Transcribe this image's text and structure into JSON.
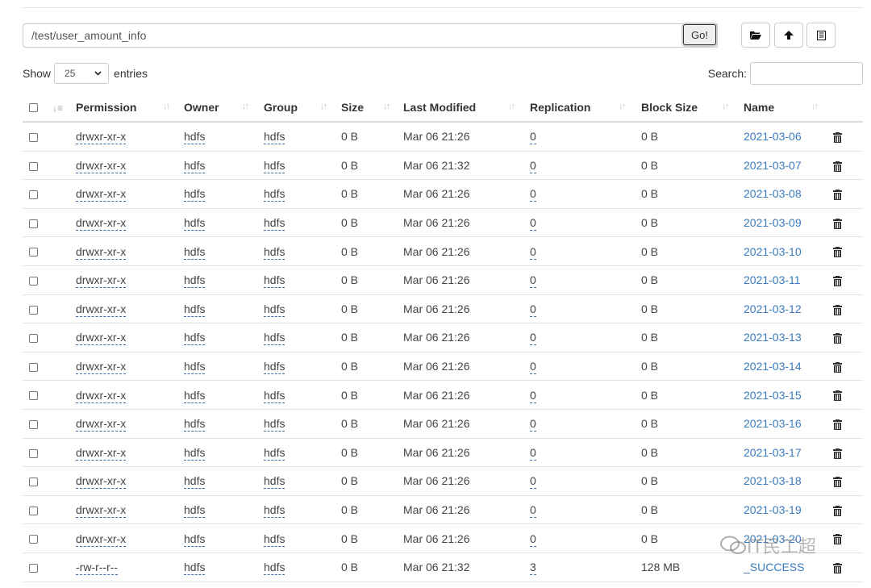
{
  "path_bar": {
    "path_value": "/test/user_amount_info",
    "go_label": "Go!"
  },
  "toolbar": {
    "icons": [
      "folder-open-icon",
      "upload-icon",
      "list-icon"
    ]
  },
  "length_control": {
    "show_label": "Show",
    "selected_value": "25",
    "entries_label": "entries"
  },
  "search": {
    "label": "Search:",
    "value": ""
  },
  "table": {
    "headers": [
      "Permission",
      "Owner",
      "Group",
      "Size",
      "Last Modified",
      "Replication",
      "Block Size",
      "Name"
    ],
    "rows": [
      {
        "permission": "drwxr-xr-x",
        "owner": "hdfs",
        "group": "hdfs",
        "size": "0 B",
        "modified": "Mar 06 21:26",
        "replication": "0",
        "block_size": "0 B",
        "name": "2021-03-06"
      },
      {
        "permission": "drwxr-xr-x",
        "owner": "hdfs",
        "group": "hdfs",
        "size": "0 B",
        "modified": "Mar 06 21:32",
        "replication": "0",
        "block_size": "0 B",
        "name": "2021-03-07"
      },
      {
        "permission": "drwxr-xr-x",
        "owner": "hdfs",
        "group": "hdfs",
        "size": "0 B",
        "modified": "Mar 06 21:26",
        "replication": "0",
        "block_size": "0 B",
        "name": "2021-03-08"
      },
      {
        "permission": "drwxr-xr-x",
        "owner": "hdfs",
        "group": "hdfs",
        "size": "0 B",
        "modified": "Mar 06 21:26",
        "replication": "0",
        "block_size": "0 B",
        "name": "2021-03-09"
      },
      {
        "permission": "drwxr-xr-x",
        "owner": "hdfs",
        "group": "hdfs",
        "size": "0 B",
        "modified": "Mar 06 21:26",
        "replication": "0",
        "block_size": "0 B",
        "name": "2021-03-10"
      },
      {
        "permission": "drwxr-xr-x",
        "owner": "hdfs",
        "group": "hdfs",
        "size": "0 B",
        "modified": "Mar 06 21:26",
        "replication": "0",
        "block_size": "0 B",
        "name": "2021-03-11"
      },
      {
        "permission": "drwxr-xr-x",
        "owner": "hdfs",
        "group": "hdfs",
        "size": "0 B",
        "modified": "Mar 06 21:26",
        "replication": "0",
        "block_size": "0 B",
        "name": "2021-03-12"
      },
      {
        "permission": "drwxr-xr-x",
        "owner": "hdfs",
        "group": "hdfs",
        "size": "0 B",
        "modified": "Mar 06 21:26",
        "replication": "0",
        "block_size": "0 B",
        "name": "2021-03-13"
      },
      {
        "permission": "drwxr-xr-x",
        "owner": "hdfs",
        "group": "hdfs",
        "size": "0 B",
        "modified": "Mar 06 21:26",
        "replication": "0",
        "block_size": "0 B",
        "name": "2021-03-14"
      },
      {
        "permission": "drwxr-xr-x",
        "owner": "hdfs",
        "group": "hdfs",
        "size": "0 B",
        "modified": "Mar 06 21:26",
        "replication": "0",
        "block_size": "0 B",
        "name": "2021-03-15"
      },
      {
        "permission": "drwxr-xr-x",
        "owner": "hdfs",
        "group": "hdfs",
        "size": "0 B",
        "modified": "Mar 06 21:26",
        "replication": "0",
        "block_size": "0 B",
        "name": "2021-03-16"
      },
      {
        "permission": "drwxr-xr-x",
        "owner": "hdfs",
        "group": "hdfs",
        "size": "0 B",
        "modified": "Mar 06 21:26",
        "replication": "0",
        "block_size": "0 B",
        "name": "2021-03-17"
      },
      {
        "permission": "drwxr-xr-x",
        "owner": "hdfs",
        "group": "hdfs",
        "size": "0 B",
        "modified": "Mar 06 21:26",
        "replication": "0",
        "block_size": "0 B",
        "name": "2021-03-18"
      },
      {
        "permission": "drwxr-xr-x",
        "owner": "hdfs",
        "group": "hdfs",
        "size": "0 B",
        "modified": "Mar 06 21:26",
        "replication": "0",
        "block_size": "0 B",
        "name": "2021-03-19"
      },
      {
        "permission": "drwxr-xr-x",
        "owner": "hdfs",
        "group": "hdfs",
        "size": "0 B",
        "modified": "Mar 06 21:26",
        "replication": "0",
        "block_size": "0 B",
        "name": "2021-03-20"
      },
      {
        "permission": "-rw-r--r--",
        "owner": "hdfs",
        "group": "hdfs",
        "size": "0 B",
        "modified": "Mar 06 21:32",
        "replication": "3",
        "block_size": "128 MB",
        "name": "_SUCCESS"
      }
    ]
  },
  "watermark": {
    "text": "IT民工超"
  },
  "colors": {
    "link": "#3a7bbf",
    "border": "#dddddd"
  }
}
